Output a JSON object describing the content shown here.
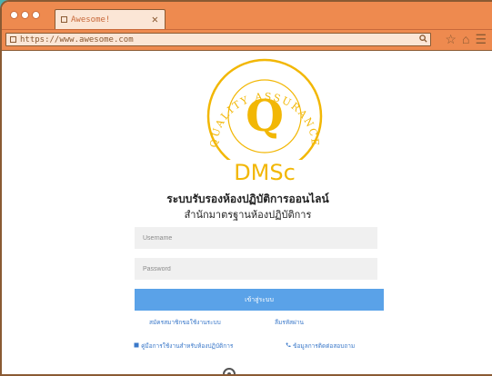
{
  "browser": {
    "tab_title": "Awesome!",
    "tab_close": "✕",
    "url": "https://www.awesome.com",
    "search_glyph": "🔍",
    "star_glyph": "☆",
    "home_glyph": "⌂",
    "menu_glyph": "☰"
  },
  "logo": {
    "ring_text_top": "QUALITY ASSURANCE",
    "letter": "Q",
    "brand": "DMSc",
    "color": "#f2b705"
  },
  "page": {
    "title": "ระบบรับรองห้องปฏิบัติการออนไลน์",
    "subtitle": "สำนักมาตรฐานห้องปฏิบัติการ"
  },
  "form": {
    "username_placeholder": "Username",
    "password_placeholder": "Password",
    "login_label": "เข้าสู่ระบบ"
  },
  "links": {
    "register": "สมัครสมาชิกขอใช้งานระบบ",
    "forgot": "ลืมรหัสผ่าน",
    "manual": "คู่มือการใช้งานสำหรับห้องปฏิบัติการ",
    "contact": "ข้อมูลการติดต่อสอบถาม"
  }
}
